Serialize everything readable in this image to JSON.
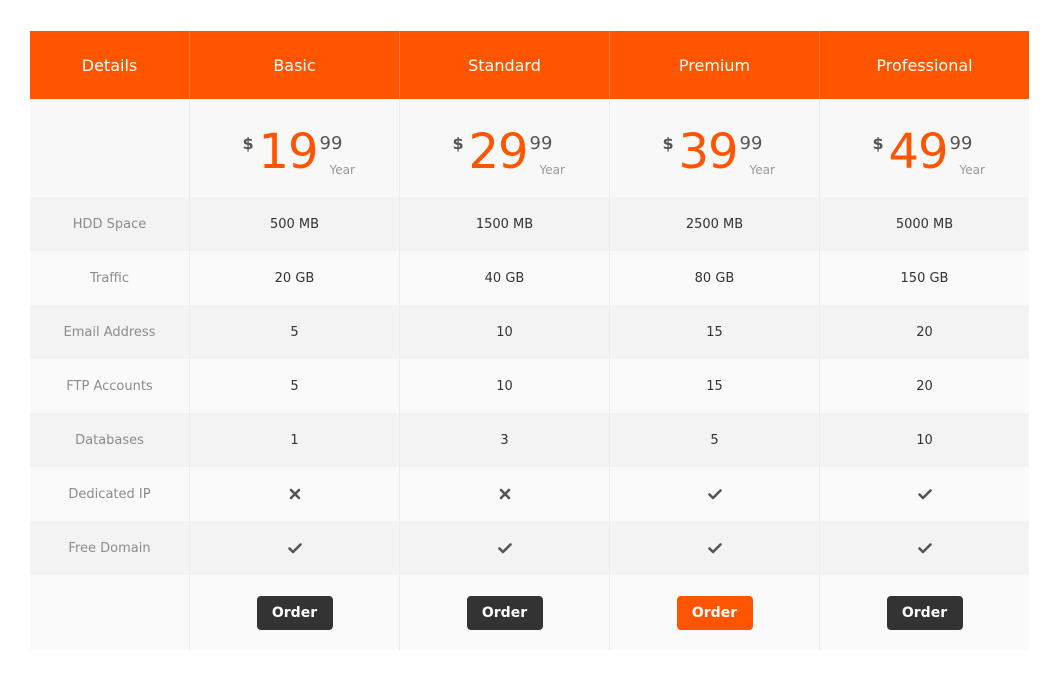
{
  "colors": {
    "accent": "#ff5400",
    "button": "#333333"
  },
  "header": {
    "details_label": "Details",
    "plans": [
      "Basic",
      "Standard",
      "Premium",
      "Professional"
    ]
  },
  "prices": [
    {
      "currency": "$",
      "amount": "19",
      "cents": "99",
      "period": "Year"
    },
    {
      "currency": "$",
      "amount": "29",
      "cents": "99",
      "period": "Year"
    },
    {
      "currency": "$",
      "amount": "39",
      "cents": "99",
      "period": "Year"
    },
    {
      "currency": "$",
      "amount": "49",
      "cents": "99",
      "period": "Year"
    }
  ],
  "features": [
    {
      "label": "HDD Space",
      "values": [
        "500 MB",
        "1500 MB",
        "2500 MB",
        "5000 MB"
      ]
    },
    {
      "label": "Traffic",
      "values": [
        "20 GB",
        "40 GB",
        "80 GB",
        "150 GB"
      ]
    },
    {
      "label": "Email Address",
      "values": [
        "5",
        "10",
        "15",
        "20"
      ]
    },
    {
      "label": "FTP Accounts",
      "values": [
        "5",
        "10",
        "15",
        "20"
      ]
    },
    {
      "label": "Databases",
      "values": [
        "1",
        "3",
        "5",
        "10"
      ]
    },
    {
      "label": "Dedicated IP",
      "icons": [
        "cross-icon",
        "cross-icon",
        "check-icon",
        "check-icon"
      ]
    },
    {
      "label": "Free Domain",
      "icons": [
        "check-icon",
        "check-icon",
        "check-icon",
        "check-icon"
      ]
    }
  ],
  "order": {
    "label": "Order",
    "highlighted_plan": "Premium"
  }
}
